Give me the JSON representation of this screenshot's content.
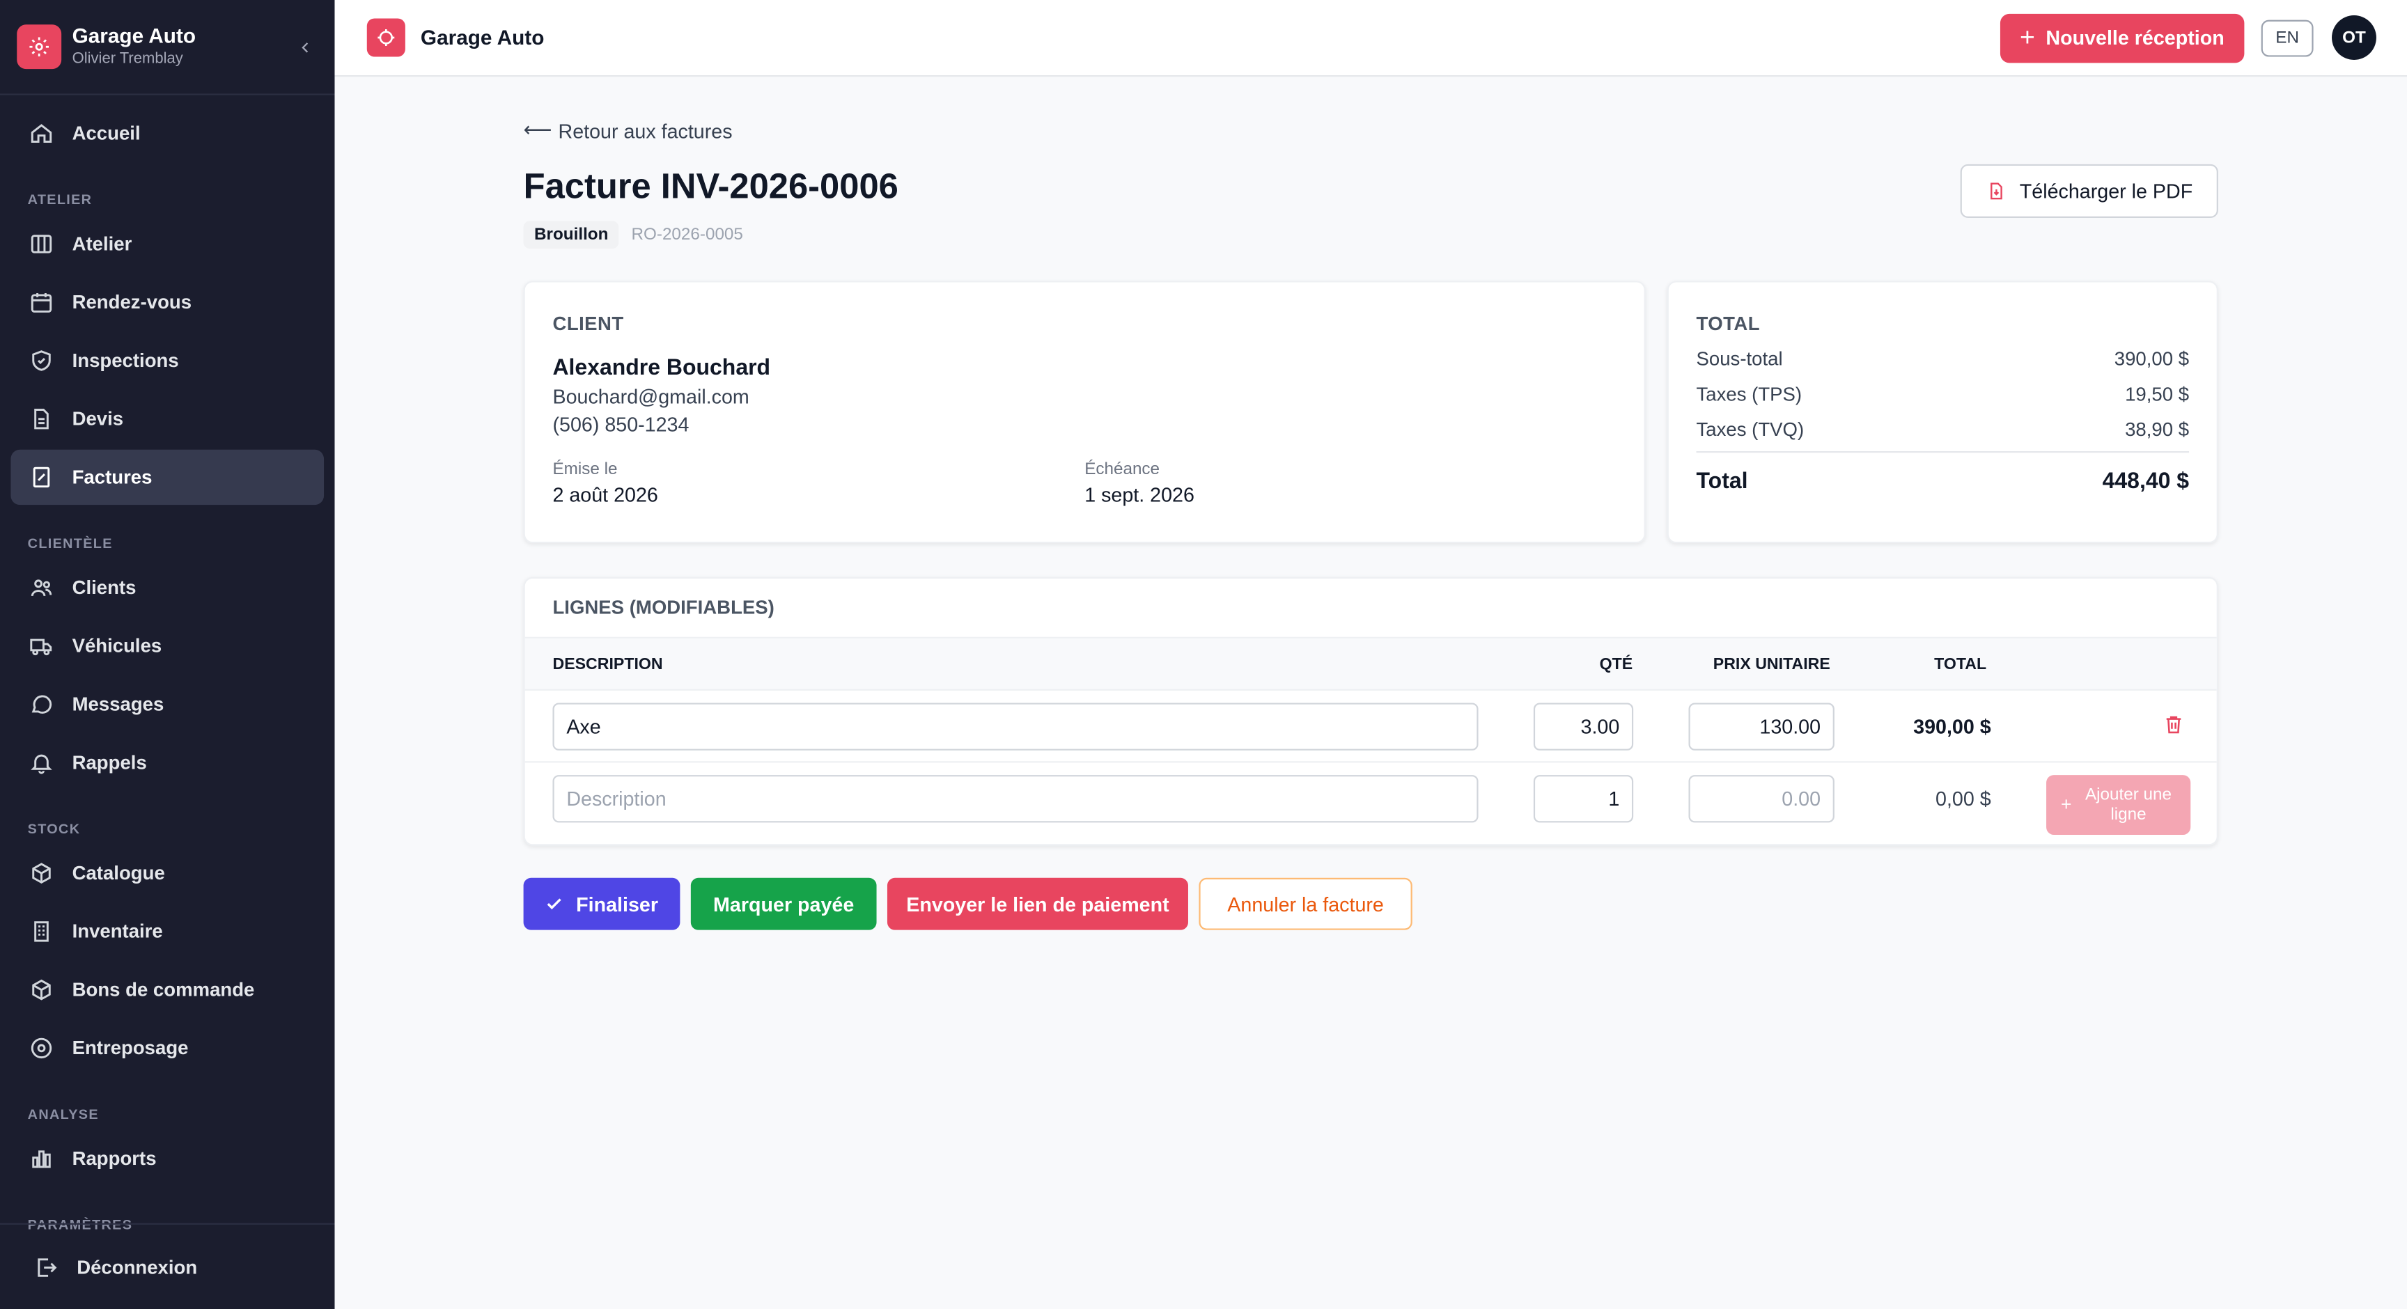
{
  "colors": {
    "brand": "#e8455f",
    "sidebar_bg": "#1b1d2e",
    "finalize": "#4f46e5",
    "paid": "#16a34a",
    "cancel": "#ea580c"
  },
  "sidebar": {
    "app_name": "Garage Auto",
    "user_name": "Olivier Tremblay",
    "home": "Accueil",
    "sections": {
      "atelier": "ATELIER",
      "clientele": "CLIENTÈLE",
      "stock": "STOCK",
      "analyse": "ANALYSE",
      "parametres": "PARAMÈTRES"
    },
    "items": {
      "atelier": "Atelier",
      "rendezvous": "Rendez-vous",
      "inspections": "Inspections",
      "devis": "Devis",
      "factures": "Factures",
      "clients": "Clients",
      "vehicules": "Véhicules",
      "messages": "Messages",
      "rappels": "Rappels",
      "catalogue": "Catalogue",
      "inventaire": "Inventaire",
      "bons": "Bons de commande",
      "entreposage": "Entreposage",
      "rapports": "Rapports"
    },
    "logout": "Déconnexion"
  },
  "topbar": {
    "title": "Garage Auto",
    "new_button": "Nouvelle réception",
    "lang": "EN",
    "avatar": "OT"
  },
  "page": {
    "back": "Retour aux factures",
    "title": "Facture INV-2026-0006",
    "status": "Brouillon",
    "ro": "RO-2026-0005",
    "pdf_button": "Télécharger le PDF"
  },
  "client": {
    "label": "CLIENT",
    "name": "Alexandre Bouchard",
    "email": "Bouchard@gmail.com",
    "phone": "(506) 850-1234",
    "issued_label": "Émise le",
    "issued": "2 août 2026",
    "due_label": "Échéance",
    "due": "1 sept. 2026"
  },
  "totals": {
    "label": "TOTAL",
    "subtotal_label": "Sous-total",
    "subtotal": "390,00 $",
    "tps_label": "Taxes (TPS)",
    "tps": "19,50 $",
    "tvq_label": "Taxes (TVQ)",
    "tvq": "38,90 $",
    "total_label": "Total",
    "total": "448,40 $"
  },
  "lines": {
    "label": "LIGNES (MODIFIABLES)",
    "columns": {
      "description": "DESCRIPTION",
      "qty": "QTÉ",
      "unit_price": "PRIX UNITAIRE",
      "total": "TOTAL"
    },
    "rows": [
      {
        "description": "Axe",
        "qty": "3.00",
        "unit_price": "130.00",
        "total": "390,00 $"
      }
    ],
    "new_row": {
      "description_placeholder": "Description",
      "qty": "1",
      "price_placeholder": "0.00",
      "total": "0,00 $",
      "add_button": "Ajouter une ligne"
    }
  },
  "actions": {
    "finalize": "Finaliser",
    "mark_paid": "Marquer payée",
    "send_link": "Envoyer le lien de paiement",
    "cancel": "Annuler la facture"
  }
}
